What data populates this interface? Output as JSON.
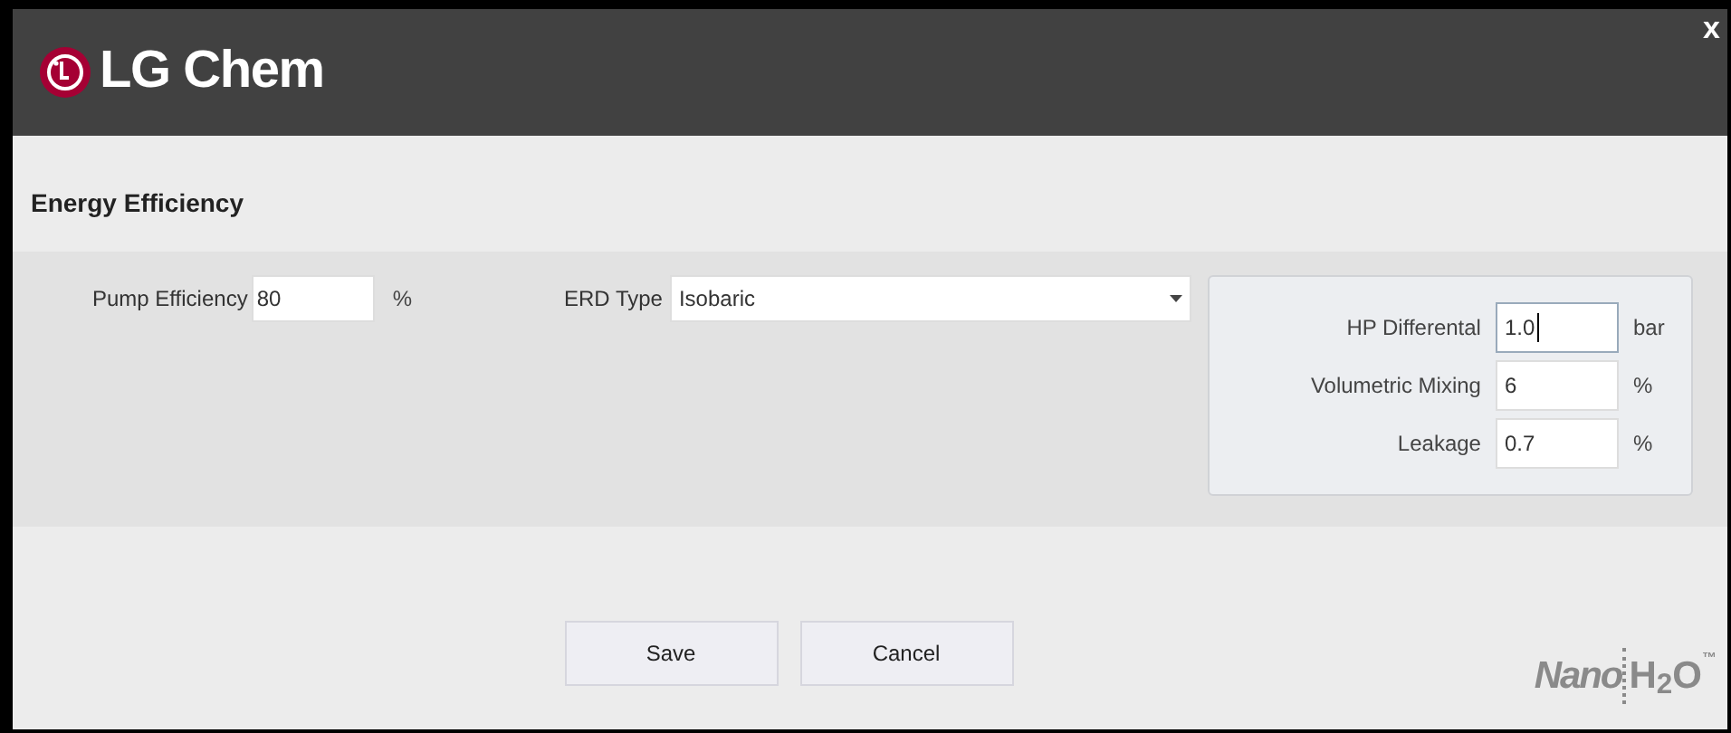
{
  "header": {
    "logo_text": "LG Chem",
    "close": "x"
  },
  "section": {
    "title": "Energy Efficiency"
  },
  "pump": {
    "label": "Pump Efficiency",
    "value": "80",
    "unit": "%"
  },
  "erd": {
    "label": "ERD Type",
    "value": "Isobaric"
  },
  "erd_fields": [
    {
      "label": "HP Differental",
      "value": "1.0",
      "unit": "bar",
      "focused": true
    },
    {
      "label": "Volumetric Mixing",
      "value": "6",
      "unit": "%",
      "focused": false
    },
    {
      "label": "Leakage",
      "value": "0.7",
      "unit": "%",
      "focused": false
    }
  ],
  "buttons": [
    "Save",
    "Cancel"
  ],
  "footer_logo": {
    "word": "Nano",
    "formula": "H$_{2}$O",
    "mark": "™"
  }
}
